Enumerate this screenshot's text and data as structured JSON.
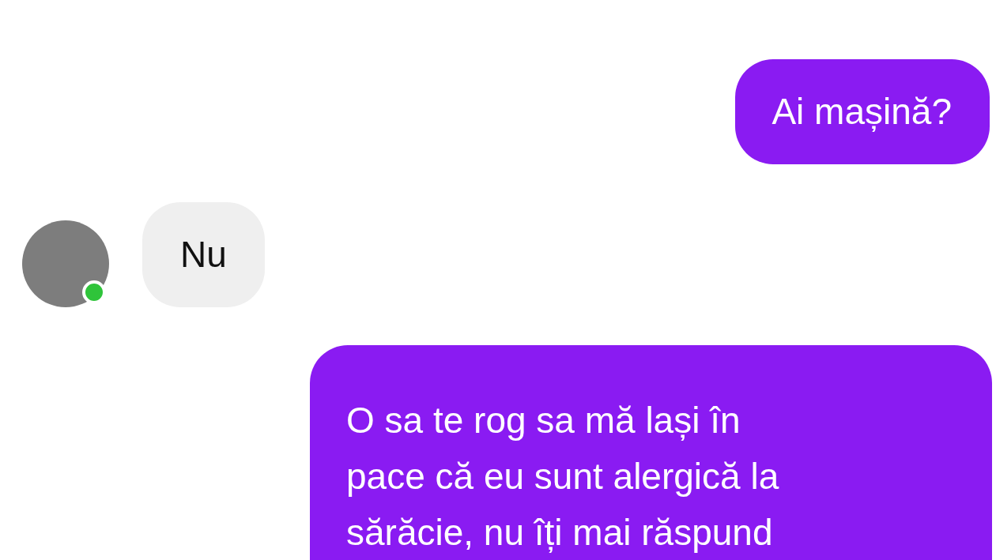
{
  "messages": [
    {
      "kind": "sent",
      "lines": [
        "Ai mașină?"
      ]
    },
    {
      "kind": "received",
      "lines": [
        "Nu"
      ],
      "sender": {
        "online": true
      }
    },
    {
      "kind": "sent",
      "lines": [
        "O sa te rog sa mă lași în",
        "pace că eu sunt alergică la",
        "sărăcie, nu îți mai răspund"
      ]
    }
  ]
}
